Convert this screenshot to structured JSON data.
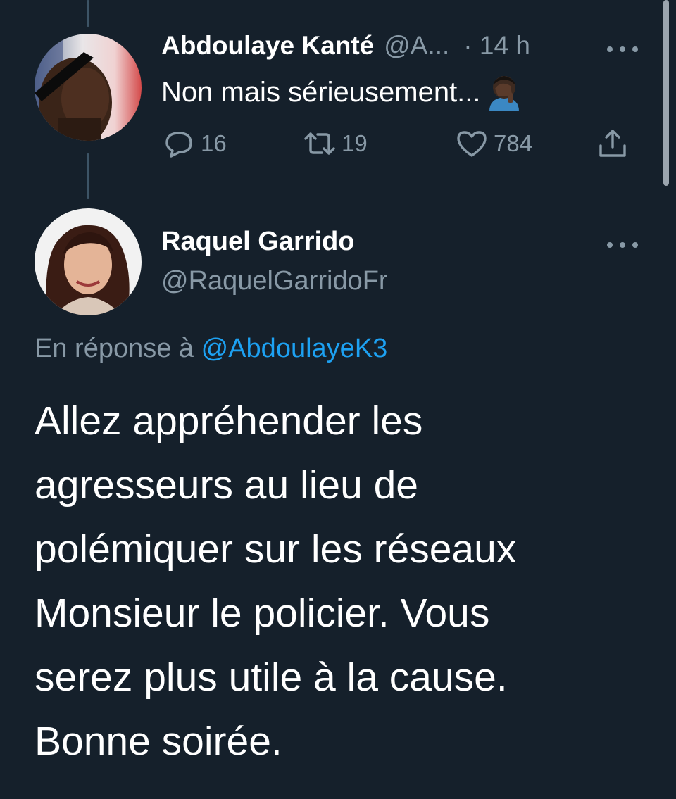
{
  "tweets": [
    {
      "name": "Abdoulaye Kanté",
      "handle": "@A...",
      "time": "· 14 h",
      "text": "Non mais sérieusement...",
      "emoji": "man-facepalming-dark-skin",
      "stats": {
        "replies": "16",
        "retweets": "19",
        "likes": "784"
      }
    },
    {
      "name": "Raquel Garrido",
      "handle": "@RaquelGarridoFr",
      "reply_prefix": "En réponse à",
      "reply_mention": "@AbdoulayeK3",
      "body_lines": [
        "Allez appréhender les",
        "agresseurs au lieu de",
        "polémiquer sur les réseaux",
        "Monsieur le policier. Vous",
        "serez plus utile à la cause.",
        "Bonne soirée."
      ]
    }
  ],
  "icons": {
    "reply": "reply-icon",
    "retweet": "retweet-icon",
    "like": "heart-icon",
    "share": "share-icon",
    "more": "more-dots-icon"
  },
  "colors": {
    "background": "#15202b",
    "secondary_text": "#8899a6",
    "link": "#1da1f2",
    "thread_line": "#3d5466"
  }
}
